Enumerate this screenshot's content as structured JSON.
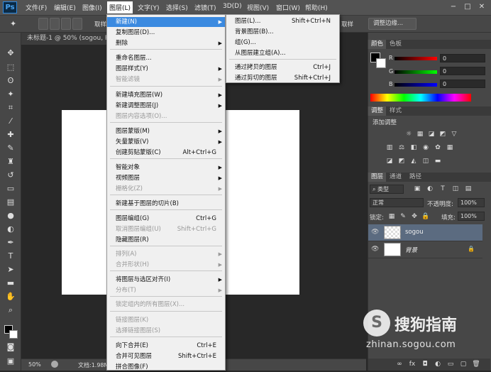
{
  "menubar": {
    "logo": "Ps",
    "items": [
      "文件(F)",
      "编辑(E)",
      "图像(I)",
      "图层(L)",
      "文字(Y)",
      "选择(S)",
      "滤镜(T)",
      "3D(D)",
      "视图(V)",
      "窗口(W)",
      "帮助(H)"
    ],
    "active_index": 3,
    "window_controls": [
      "−",
      "□",
      "✕"
    ]
  },
  "options": {
    "cancel_label": "取样",
    "right_label": "取样",
    "adjust_edge": "调整边缘..."
  },
  "document": {
    "tab_title": "未标题-1 @ 50% (sogou, RG",
    "zoom": "50%",
    "doc_info": "文档:1.98M"
  },
  "layer_menu": {
    "items": [
      {
        "label": "新建(N)",
        "shortcut": "",
        "submenu": true,
        "disabled": false,
        "highlighted": true
      },
      {
        "label": "复制图层(D)...",
        "shortcut": "",
        "submenu": false,
        "disabled": false
      },
      {
        "label": "删除",
        "shortcut": "",
        "submenu": true,
        "disabled": false
      },
      {
        "label": "重命名图层...",
        "shortcut": "",
        "submenu": false,
        "disabled": false
      },
      {
        "label": "图层样式(Y)",
        "shortcut": "",
        "submenu": true,
        "disabled": false
      },
      {
        "label": "智能滤镜",
        "shortcut": "",
        "submenu": true,
        "disabled": true
      },
      {
        "label": "新建填充图层(W)",
        "shortcut": "",
        "submenu": true,
        "disabled": false
      },
      {
        "label": "新建调整图层(J)",
        "shortcut": "",
        "submenu": true,
        "disabled": false
      },
      {
        "label": "图层内容选项(O)...",
        "shortcut": "",
        "submenu": false,
        "disabled": true
      },
      {
        "label": "图层蒙版(M)",
        "shortcut": "",
        "submenu": true,
        "disabled": false
      },
      {
        "label": "矢量蒙版(V)",
        "shortcut": "",
        "submenu": true,
        "disabled": false
      },
      {
        "label": "创建剪贴蒙版(C)",
        "shortcut": "Alt+Ctrl+G",
        "submenu": false,
        "disabled": false
      },
      {
        "label": "智能对象",
        "shortcut": "",
        "submenu": true,
        "disabled": false
      },
      {
        "label": "视频图层",
        "shortcut": "",
        "submenu": true,
        "disabled": false
      },
      {
        "label": "栅格化(Z)",
        "shortcut": "",
        "submenu": true,
        "disabled": true
      },
      {
        "label": "新建基于图层的切片(B)",
        "shortcut": "",
        "submenu": false,
        "disabled": false
      },
      {
        "label": "图层编组(G)",
        "shortcut": "Ctrl+G",
        "submenu": false,
        "disabled": false
      },
      {
        "label": "取消图层编组(U)",
        "shortcut": "Shift+Ctrl+G",
        "submenu": false,
        "disabled": true
      },
      {
        "label": "隐藏图层(R)",
        "shortcut": "",
        "submenu": false,
        "disabled": false
      },
      {
        "label": "排列(A)",
        "shortcut": "",
        "submenu": true,
        "disabled": true
      },
      {
        "label": "合并形状(H)",
        "shortcut": "",
        "submenu": true,
        "disabled": true
      },
      {
        "label": "将图层与选区对齐(I)",
        "shortcut": "",
        "submenu": true,
        "disabled": false
      },
      {
        "label": "分布(T)",
        "shortcut": "",
        "submenu": true,
        "disabled": true
      },
      {
        "label": "锁定组内的所有图层(X)...",
        "shortcut": "",
        "submenu": false,
        "disabled": true
      },
      {
        "label": "链接图层(K)",
        "shortcut": "",
        "submenu": false,
        "disabled": true
      },
      {
        "label": "选择链接图层(S)",
        "shortcut": "",
        "submenu": false,
        "disabled": true
      },
      {
        "label": "向下合并(E)",
        "shortcut": "Ctrl+E",
        "submenu": false,
        "disabled": false
      },
      {
        "label": "合并可见图层",
        "shortcut": "Shift+Ctrl+E",
        "submenu": false,
        "disabled": false
      },
      {
        "label": "拼合图像(F)",
        "shortcut": "",
        "submenu": false,
        "disabled": false
      }
    ]
  },
  "new_submenu": {
    "items": [
      {
        "label": "图层(L)...",
        "shortcut": "Shift+Ctrl+N"
      },
      {
        "label": "背景图层(B)...",
        "shortcut": ""
      },
      {
        "label": "组(G)...",
        "shortcut": ""
      },
      {
        "label": "从图层建立组(A)...",
        "shortcut": ""
      },
      {
        "label": "通过拷贝的图层",
        "shortcut": "Ctrl+J"
      },
      {
        "label": "通过剪切的图层",
        "shortcut": "Shift+Ctrl+J"
      }
    ]
  },
  "color_panel": {
    "tabs": [
      "颜色",
      "色板"
    ],
    "channels": [
      {
        "label": "R",
        "value": "0"
      },
      {
        "label": "G",
        "value": "0"
      },
      {
        "label": "B",
        "value": "0"
      }
    ]
  },
  "adjust_panel": {
    "tabs": [
      "调整",
      "样式"
    ],
    "title": "添加调整"
  },
  "layers_panel": {
    "tabs": [
      "图层",
      "通道",
      "路径"
    ],
    "filter_kind": "类型",
    "blend_mode": "正常",
    "opacity_label": "不透明度:",
    "opacity": "100%",
    "lock_label": "锁定:",
    "fill_label": "填充:",
    "fill": "100%",
    "layers": [
      {
        "name": "sogou",
        "selected": true
      },
      {
        "name": "背景",
        "selected": false
      }
    ],
    "footer_icons": [
      "link-icon",
      "fx-icon",
      "mask-icon",
      "adjustment-icon",
      "folder-icon",
      "new-layer-icon",
      "trash-icon"
    ]
  },
  "watermark": {
    "brand": "搜狗指南",
    "url": "zhinan.sogou.com",
    "logo_glyph": "S"
  }
}
